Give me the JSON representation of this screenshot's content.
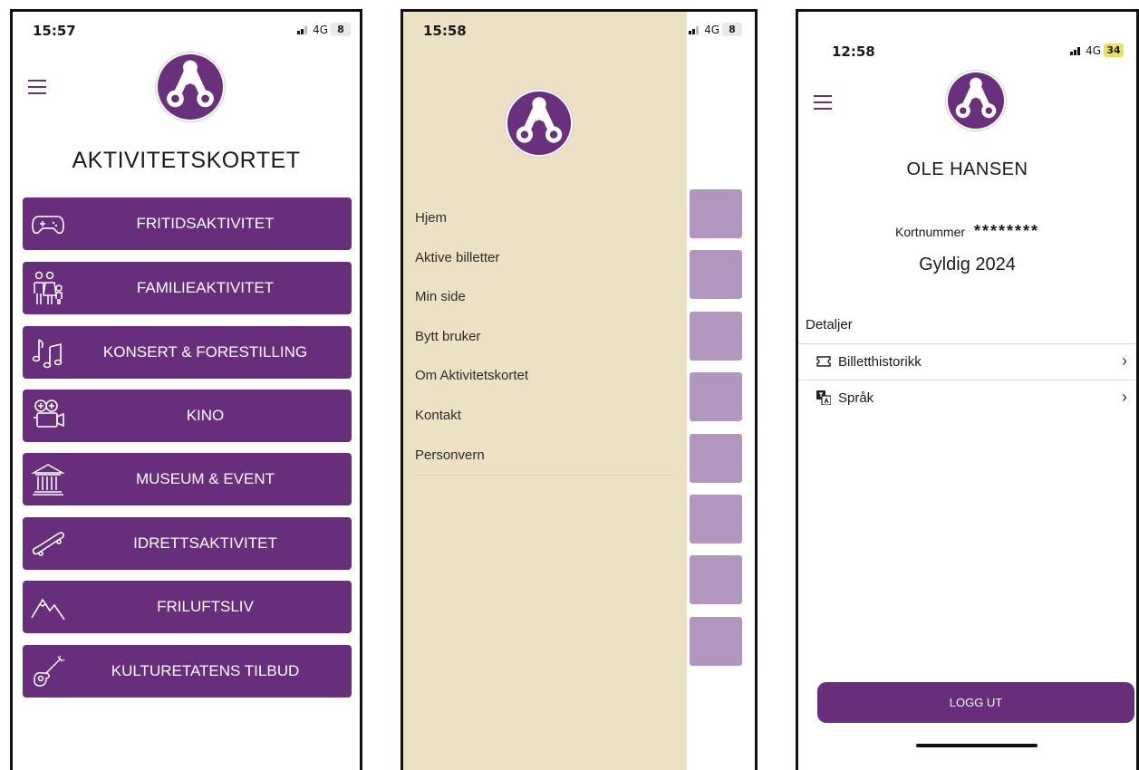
{
  "screen1": {
    "time": "15:57",
    "network": "4G",
    "battery": "8",
    "title": "AKTIVITETSKORTET",
    "categories": [
      {
        "label": "FRITIDSAKTIVITET",
        "icon": "gamepad-icon"
      },
      {
        "label": "FAMILIEAKTIVITET",
        "icon": "family-icon"
      },
      {
        "label": "KONSERT & FORESTILLING",
        "icon": "music-note-icon"
      },
      {
        "label": "KINO",
        "icon": "film-camera-icon"
      },
      {
        "label": "MUSEUM & EVENT",
        "icon": "museum-icon"
      },
      {
        "label": "IDRETTSAKTIVITET",
        "icon": "skateboard-icon"
      },
      {
        "label": "FRILUFTSLIV",
        "icon": "mountain-icon"
      },
      {
        "label": "KULTURETATENS TILBUD",
        "icon": "guitar-icon"
      }
    ]
  },
  "screen2": {
    "time": "15:58",
    "network": "4G",
    "battery": "8",
    "menu": [
      "Hjem",
      "Aktive billetter",
      "Min side",
      "Bytt bruker",
      "Om Aktivitetskortet",
      "Kontakt",
      "Personvern"
    ]
  },
  "screen3": {
    "time": "12:58",
    "network": "4G",
    "battery": "34",
    "name": "OLE HANSEN",
    "card_label": "Kortnummer",
    "card_number": "********",
    "valid": "Gyldig 2024",
    "details_heading": "Detaljer",
    "rows": [
      {
        "label": "Billetthistorikk",
        "icon": "ticket-icon"
      },
      {
        "label": "Språk",
        "icon": "translate-icon"
      }
    ],
    "logout": "LOGG UT"
  },
  "colors": {
    "brand": "#682d7b",
    "drawer": "#ece0c5",
    "button_faded": "#b196c0"
  }
}
